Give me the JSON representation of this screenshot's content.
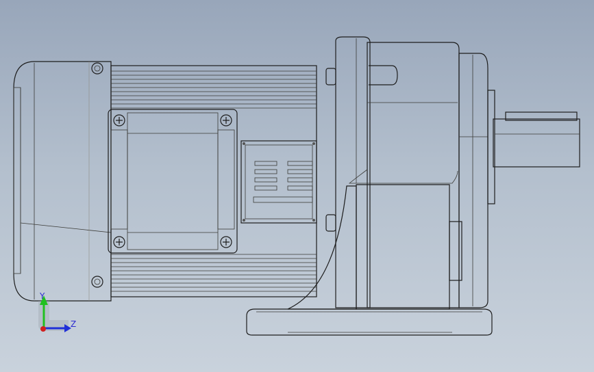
{
  "colors": {
    "background_top": "#98a6ba",
    "background_bottom": "#c9d2dc",
    "metal": "#bdbcb1",
    "axis_y": "#20c020",
    "axis_z": "#2030d8",
    "axis_origin": "#d02020"
  },
  "triad": {
    "y_label": "Y",
    "z_label": "Z"
  },
  "icons": [
    "screw-icon",
    "nameplate-icon",
    "axis-triad-icon"
  ]
}
